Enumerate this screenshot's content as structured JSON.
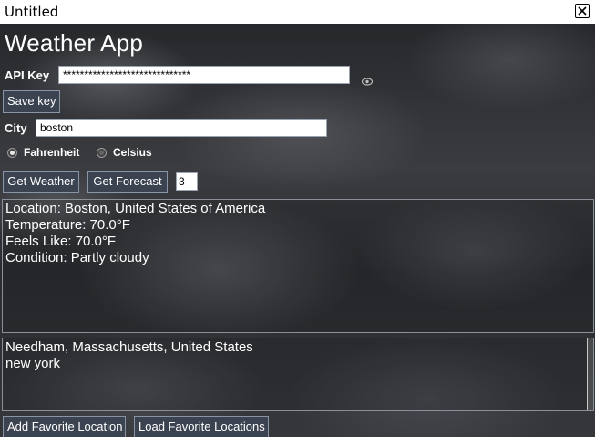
{
  "window": {
    "title": "Untitled"
  },
  "app": {
    "heading": "Weather App"
  },
  "api_key": {
    "label": "API Key",
    "value": "******************************"
  },
  "save_key": {
    "label": "Save key"
  },
  "city": {
    "label": "City",
    "value": "boston"
  },
  "units": {
    "options": [
      {
        "label": "Fahrenheit",
        "selected": true
      },
      {
        "label": "Celsius",
        "selected": false
      }
    ]
  },
  "actions": {
    "get_weather": "Get Weather",
    "get_forecast": "Get Forecast",
    "forecast_days": "3"
  },
  "weather_output": {
    "lines": [
      "Location: Boston, United States of America",
      "Temperature: 70.0°F",
      "Feels Like: 70.0°F",
      "Condition: Partly cloudy"
    ]
  },
  "favorites": {
    "items": [
      "Needham, Massachusetts, United States",
      "new york"
    ],
    "add_label": "Add Favorite Location",
    "load_label": "Load Favorite Locations"
  }
}
